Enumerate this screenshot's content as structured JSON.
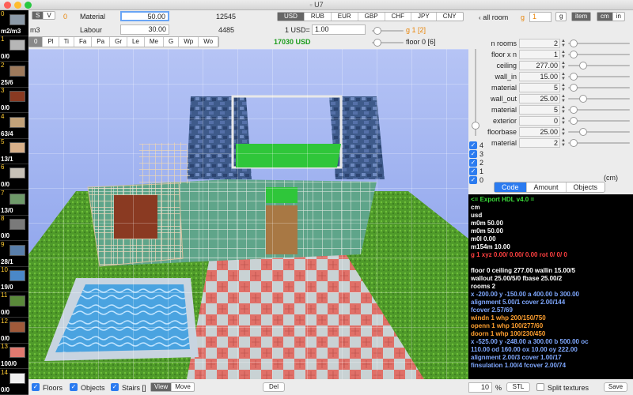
{
  "window": {
    "title": "U7"
  },
  "units": {
    "m2m3": "m2/m3",
    "m3": "m3",
    "s_btn": "S",
    "v_btn": "V",
    "zero": "0"
  },
  "costs": {
    "material_label": "Material",
    "material_value": "50.00",
    "material_total": "12545",
    "labour_label": "Labour",
    "labour_value": "30.00",
    "labour_total": "4485",
    "total": "17030 USD"
  },
  "currency": {
    "options": [
      "USD",
      "RUB",
      "EUR",
      "GBP",
      "CHF",
      "JPY",
      "CNY"
    ],
    "selected": "USD",
    "rate_label": "1 USD=",
    "rate_value": "1.00",
    "all_room": "all room"
  },
  "group": {
    "g_label": "g",
    "g_value": "1",
    "g_btn": "g",
    "item_btn": "item",
    "cm_btn": "cm",
    "in_btn": "in"
  },
  "sliders_top": {
    "g_label": "g 1 [2]",
    "floor_label": "floor 0 [6]"
  },
  "categories": [
    "0",
    "Pl",
    "Ti",
    "Fa",
    "Pa",
    "Gr",
    "Le",
    "Me",
    "G",
    "Wp",
    "Wo"
  ],
  "palette": [
    {
      "num": "0",
      "val": "m2/m3",
      "color": "#8c9aa8"
    },
    {
      "num": "1",
      "val": "0/0",
      "color": "#b6b6b6"
    },
    {
      "num": "2",
      "val": "25/6",
      "color": "#9e7a5c"
    },
    {
      "num": "3",
      "val": "0/0",
      "color": "#8a3a22"
    },
    {
      "num": "4",
      "val": "63/4",
      "color": "#c2a27a"
    },
    {
      "num": "5",
      "val": "13/1",
      "color": "#d8b08a"
    },
    {
      "num": "6",
      "val": "0/0",
      "color": "#c8c2b8"
    },
    {
      "num": "7",
      "val": "13/0",
      "color": "#6f9a6a"
    },
    {
      "num": "8",
      "val": "0/0",
      "color": "#7a7a7a"
    },
    {
      "num": "9",
      "val": "28/1",
      "color": "#5a7faa"
    },
    {
      "num": "10",
      "val": "19/0",
      "color": "#4a88c8"
    },
    {
      "num": "11",
      "val": "0/0",
      "color": "#5a8a3a"
    },
    {
      "num": "12",
      "val": "0/0",
      "color": "#a05a3a"
    },
    {
      "num": "13",
      "val": "100/0",
      "color": "#e07a70"
    },
    {
      "num": "14",
      "val": "0/0",
      "color": "#f0f0f0"
    }
  ],
  "props": [
    {
      "label": "n rooms",
      "value": "2"
    },
    {
      "label": "floor x n",
      "value": "1"
    },
    {
      "label": "ceiling",
      "value": "277.00"
    },
    {
      "label": "wall_in",
      "value": "15.00"
    },
    {
      "label": "material",
      "value": "5"
    },
    {
      "label": "wall_out",
      "value": "25.00"
    },
    {
      "label": "material",
      "value": "5"
    },
    {
      "label": "exterior",
      "value": "0"
    },
    {
      "label": "floorbase",
      "value": "25.00"
    },
    {
      "label": "material",
      "value": "2"
    }
  ],
  "floors": [
    "4",
    "3",
    "2",
    "1",
    "0"
  ],
  "cm_note": "(cm)",
  "code_tabs": [
    "Code",
    "Amount",
    "Objects"
  ],
  "code_lines": [
    {
      "text": "<= Export HDL v4.0 =",
      "color": "#3adf3a"
    },
    {
      "text": "cm",
      "color": "#ffffff"
    },
    {
      "text": "usd",
      "color": "#ffffff"
    },
    {
      "text": "m0m 50.00",
      "color": "#ffffff"
    },
    {
      "text": "m0m 50.00",
      "color": "#ffffff"
    },
    {
      "text": "m0l 0.00",
      "color": "#ffffff"
    },
    {
      "text": "m154m 10.00",
      "color": "#ffffff"
    },
    {
      "text": "g 1 xyz  0.00/ 0.00/ 0.00 rot  0/ 0/ 0",
      "color": "#ff4040"
    },
    {
      "text": "",
      "color": "#ffffff"
    },
    {
      "text": " floor 0 ceiling  277.00   wallin  15.00/5",
      "color": "#ffffff"
    },
    {
      "text": "wallout  25.00/5/0     fbase  25.00/2",
      "color": "#ffffff"
    },
    {
      "text": " rooms 2",
      "color": "#ffffff"
    },
    {
      "text": "  x -200.00 y -150.00 a 400.00 b 300.00",
      "color": "#7fa8ff"
    },
    {
      "text": "     alignment  5.00/1     cover  2.00/144",
      "color": "#7fa8ff"
    },
    {
      "text": "     fcover  2.57/69",
      "color": "#7fa8ff"
    },
    {
      "text": "     windn 1 whp  200/150/750",
      "color": "#ffa030"
    },
    {
      "text": "     openn 1 whp  100/277/60",
      "color": "#ffa030"
    },
    {
      "text": "     doorn 1 whp  100/230/450",
      "color": "#ffa030"
    },
    {
      "text": "  x -525.00 y -248.00 a 300.00 b 500.00 oc",
      "color": "#7fa8ff"
    },
    {
      "text": "110.00 od 160.00 ox 10.00 oy 222.00",
      "color": "#7fa8ff"
    },
    {
      "text": "     alignment  2.00/3     cover  1.00/17",
      "color": "#7fa8ff"
    },
    {
      "text": "     finsulation  1.00/4    fcover  2.00/74",
      "color": "#7fa8ff"
    }
  ],
  "bottom": {
    "floors": "Floors",
    "objects": "Objects",
    "stairs": "Stairs []",
    "view": "View",
    "move": "Move",
    "del": "Del",
    "zoom": "10",
    "zoom_unit": "%",
    "stl": "STL",
    "split": "Split textures",
    "save": "Save"
  }
}
